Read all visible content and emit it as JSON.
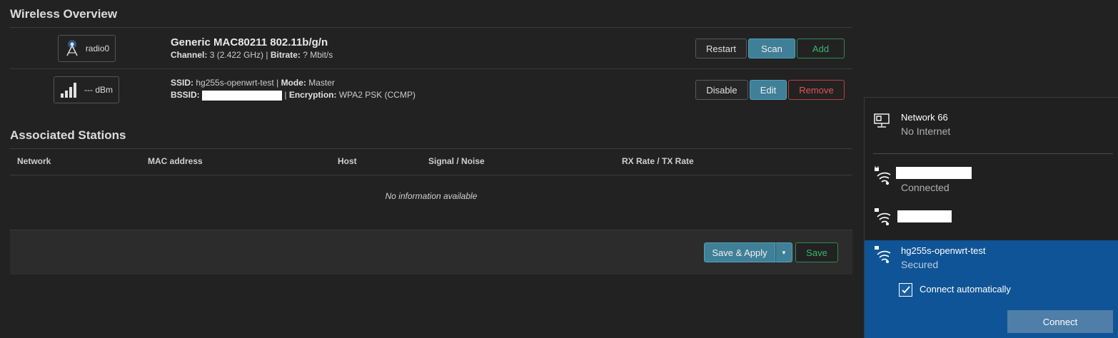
{
  "wireless_overview": {
    "title": "Wireless Overview",
    "radio": {
      "badge_label": "radio0",
      "title": "Generic MAC80211 802.11b/g/n",
      "channel_label": "Channel:",
      "channel_value": "3 (2.422 GHz)",
      "bitrate_label": "Bitrate:",
      "bitrate_value": "? Mbit/s",
      "buttons": {
        "restart": "Restart",
        "scan": "Scan",
        "add": "Add"
      }
    },
    "interface": {
      "badge_label": "--- dBm",
      "ssid_label": "SSID:",
      "ssid_value": "hg255s-openwrt-test",
      "mode_label": "Mode:",
      "mode_value": "Master",
      "bssid_label": "BSSID:",
      "encryption_label": "Encryption:",
      "encryption_value": "WPA2 PSK (CCMP)",
      "buttons": {
        "disable": "Disable",
        "edit": "Edit",
        "remove": "Remove"
      }
    }
  },
  "associated_stations": {
    "title": "Associated Stations",
    "columns": [
      "Network",
      "MAC address",
      "Host",
      "Signal / Noise",
      "RX Rate / TX Rate"
    ],
    "empty_text": "No information available"
  },
  "actions": {
    "save_apply": "Save & Apply",
    "save": "Save"
  },
  "flyout": {
    "wired": {
      "name": "Network 66",
      "status": "No Internet"
    },
    "wifi_1": {
      "status": "Connected"
    },
    "selected": {
      "name": "hg255s-openwrt-test",
      "status": "Secured",
      "auto_connect_label": "Connect automatically",
      "auto_connect_checked": true,
      "connect_button": "Connect"
    }
  },
  "colors": {
    "primary": "#3f7f97",
    "success": "#39b56c",
    "danger": "#e05555",
    "flyout_selected": "#0f5496"
  }
}
